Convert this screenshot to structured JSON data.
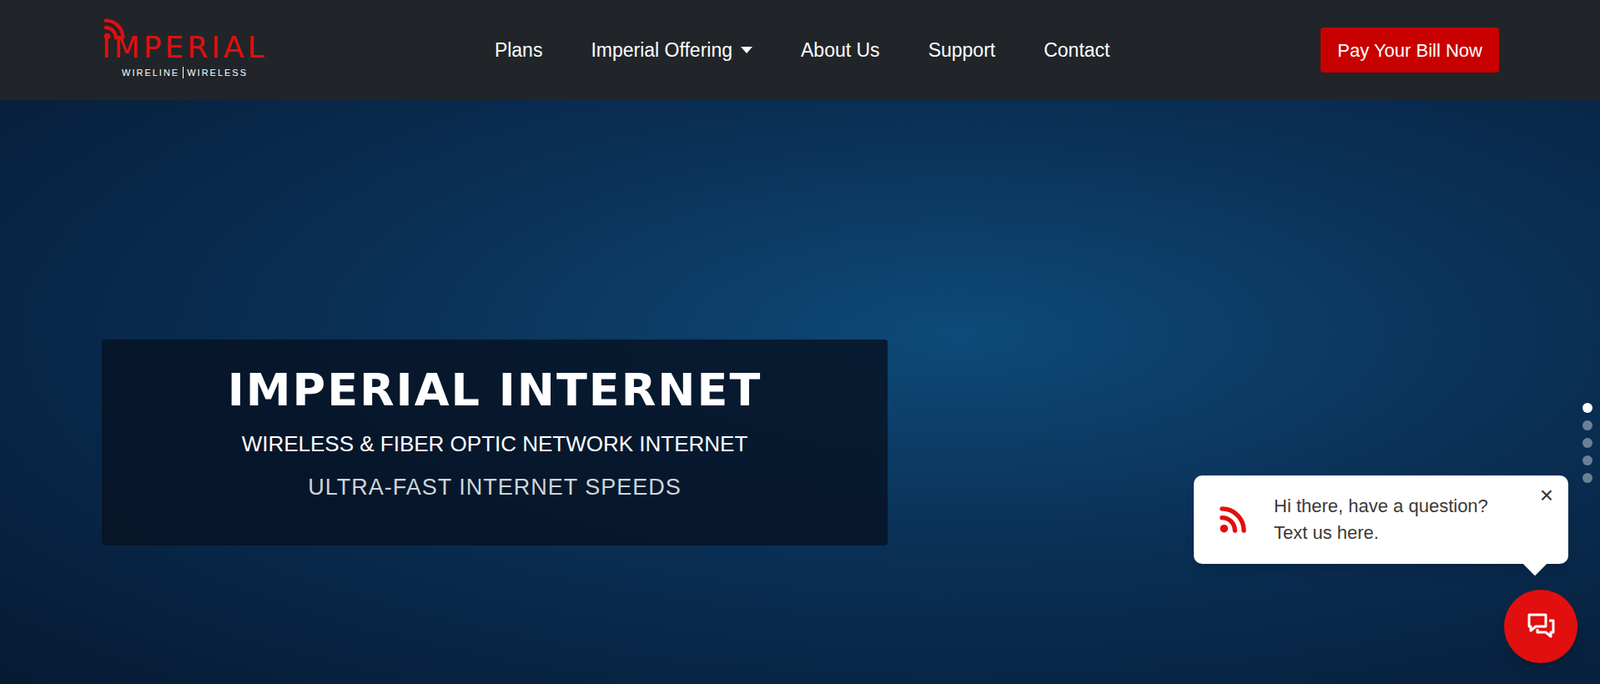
{
  "logo": {
    "name": "IMPERIAL",
    "tagline": [
      "WIRELINE",
      "WIRELESS"
    ]
  },
  "nav": [
    {
      "label": "Plans",
      "dropdown": false
    },
    {
      "label": "Imperial Offering",
      "dropdown": true
    },
    {
      "label": "About Us",
      "dropdown": false
    },
    {
      "label": "Support",
      "dropdown": false
    },
    {
      "label": "Contact",
      "dropdown": false
    }
  ],
  "cta": "Pay Your Bill Now",
  "hero": {
    "title": "IMPERIAL INTERNET",
    "subtitle": "WIRELESS & FIBER OPTIC NETWORK INTERNET",
    "tagline": "ULTRA-FAST INTERNET SPEEDS"
  },
  "carousel": {
    "dots": [
      {
        "selected": true
      },
      {
        "selected": false
      },
      {
        "selected": false
      },
      {
        "selected": false
      },
      {
        "selected": false
      }
    ]
  },
  "chat": {
    "message": [
      "Hi there, have a question?",
      "Text us here."
    ],
    "close": "×"
  }
}
